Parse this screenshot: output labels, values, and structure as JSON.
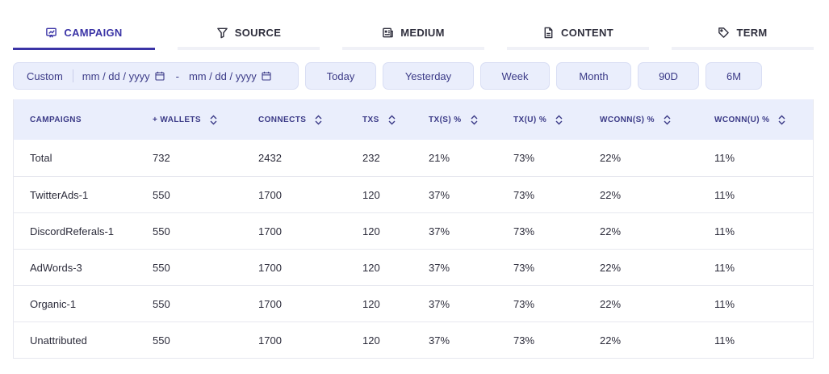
{
  "tabs": [
    {
      "label": "CAMPAIGN",
      "icon": "presentation-icon",
      "active": true
    },
    {
      "label": "SOURCE",
      "icon": "filter-icon",
      "active": false
    },
    {
      "label": "MEDIUM",
      "icon": "newspaper-icon",
      "active": false
    },
    {
      "label": "CONTENT",
      "icon": "document-icon",
      "active": false
    },
    {
      "label": "TERM",
      "icon": "tag-icon",
      "active": false
    }
  ],
  "filters": {
    "custom_label": "Custom",
    "start_date": "mm / dd / yyyy",
    "range_separator": "-",
    "end_date": "mm / dd / yyyy",
    "presets": [
      "Today",
      "Yesterday",
      "Week",
      "Month",
      "90D",
      "6M"
    ]
  },
  "table": {
    "columns": [
      "CAMPAIGNS",
      "+ WALLETS",
      "CONNECTS",
      "TXS",
      "TX(S) %",
      "TX(U) %",
      "WCONN(S) %",
      "WCONN(U) %"
    ],
    "rows": [
      [
        "Total",
        "732",
        "2432",
        "232",
        "21%",
        "73%",
        "22%",
        "11%"
      ],
      [
        "TwitterAds-1",
        "550",
        "1700",
        "120",
        "37%",
        "73%",
        "22%",
        "11%"
      ],
      [
        "DiscordReferals-1",
        "550",
        "1700",
        "120",
        "37%",
        "73%",
        "22%",
        "11%"
      ],
      [
        "AdWords-3",
        "550",
        "1700",
        "120",
        "37%",
        "73%",
        "22%",
        "11%"
      ],
      [
        "Organic-1",
        "550",
        "1700",
        "120",
        "37%",
        "73%",
        "22%",
        "11%"
      ],
      [
        "Unattributed",
        "550",
        "1700",
        "120",
        "37%",
        "73%",
        "22%",
        "11%"
      ]
    ]
  },
  "colors": {
    "accent": "#3b34a6",
    "header_bg": "#eaeefc",
    "pill_bg": "#eaeefc",
    "text": "#2b2b3a"
  }
}
